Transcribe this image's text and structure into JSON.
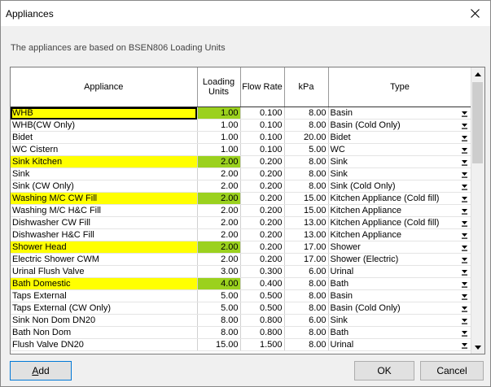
{
  "window": {
    "title": "Appliances",
    "close_label": "✕"
  },
  "description": "The appliances are based on BSEN806 Loading Units",
  "columns": [
    "Appliance",
    "Loading\nUnits",
    "Flow Rate",
    "kPa",
    "Type"
  ],
  "rows": [
    {
      "appliance": "WHB",
      "lu": "1.00",
      "flow": "0.100",
      "kpa": "8.00",
      "type": "Basin",
      "highlight": true
    },
    {
      "appliance": "WHB(CW Only)",
      "lu": "1.00",
      "flow": "0.100",
      "kpa": "8.00",
      "type": "Basin (Cold Only)",
      "highlight": false
    },
    {
      "appliance": "Bidet",
      "lu": "1.00",
      "flow": "0.100",
      "kpa": "20.00",
      "type": "Bidet",
      "highlight": false
    },
    {
      "appliance": "WC Cistern",
      "lu": "1.00",
      "flow": "0.100",
      "kpa": "5.00",
      "type": "WC",
      "highlight": false
    },
    {
      "appliance": "Sink Kitchen",
      "lu": "2.00",
      "flow": "0.200",
      "kpa": "8.00",
      "type": "Sink",
      "highlight": true
    },
    {
      "appliance": "Sink",
      "lu": "2.00",
      "flow": "0.200",
      "kpa": "8.00",
      "type": "Sink",
      "highlight": false
    },
    {
      "appliance": "Sink (CW Only)",
      "lu": "2.00",
      "flow": "0.200",
      "kpa": "8.00",
      "type": "Sink (Cold Only)",
      "highlight": false
    },
    {
      "appliance": "Washing M/C CW Fill",
      "lu": "2.00",
      "flow": "0.200",
      "kpa": "15.00",
      "type": "Kitchen Appliance (Cold fill)",
      "highlight": true
    },
    {
      "appliance": "Washing M/C H&C Fill",
      "lu": "2.00",
      "flow": "0.200",
      "kpa": "15.00",
      "type": "Kitchen Appliance",
      "highlight": false
    },
    {
      "appliance": "Dishwasher CW Fill",
      "lu": "2.00",
      "flow": "0.200",
      "kpa": "13.00",
      "type": "Kitchen Appliance (Cold fill)",
      "highlight": false
    },
    {
      "appliance": "Dishwasher H&C Fill",
      "lu": "2.00",
      "flow": "0.200",
      "kpa": "13.00",
      "type": "Kitchen Appliance",
      "highlight": false
    },
    {
      "appliance": "Shower Head",
      "lu": "2.00",
      "flow": "0.200",
      "kpa": "17.00",
      "type": "Shower",
      "highlight": true
    },
    {
      "appliance": "Electric Shower CWM",
      "lu": "2.00",
      "flow": "0.200",
      "kpa": "17.00",
      "type": "Shower (Electric)",
      "highlight": false
    },
    {
      "appliance": "Urinal Flush Valve",
      "lu": "3.00",
      "flow": "0.300",
      "kpa": "6.00",
      "type": "Urinal",
      "highlight": false
    },
    {
      "appliance": "Bath Domestic",
      "lu": "4.00",
      "flow": "0.400",
      "kpa": "8.00",
      "type": "Bath",
      "highlight": true
    },
    {
      "appliance": "Taps External",
      "lu": "5.00",
      "flow": "0.500",
      "kpa": "8.00",
      "type": "Basin",
      "highlight": false
    },
    {
      "appliance": "Taps External (CW Only)",
      "lu": "5.00",
      "flow": "0.500",
      "kpa": "8.00",
      "type": "Basin (Cold Only)",
      "highlight": false
    },
    {
      "appliance": "Sink Non Dom DN20",
      "lu": "8.00",
      "flow": "0.800",
      "kpa": "6.00",
      "type": "Sink",
      "highlight": false
    },
    {
      "appliance": "Bath Non Dom",
      "lu": "8.00",
      "flow": "0.800",
      "kpa": "8.00",
      "type": "Bath",
      "highlight": false
    },
    {
      "appliance": "Flush Valve DN20",
      "lu": "15.00",
      "flow": "1.500",
      "kpa": "8.00",
      "type": "Urinal",
      "highlight": false
    }
  ],
  "buttons": {
    "add": "Add",
    "ok": "OK",
    "cancel": "Cancel"
  },
  "colors": {
    "highlight_name": "#ffff00",
    "highlight_lu": "#9bd11e"
  }
}
